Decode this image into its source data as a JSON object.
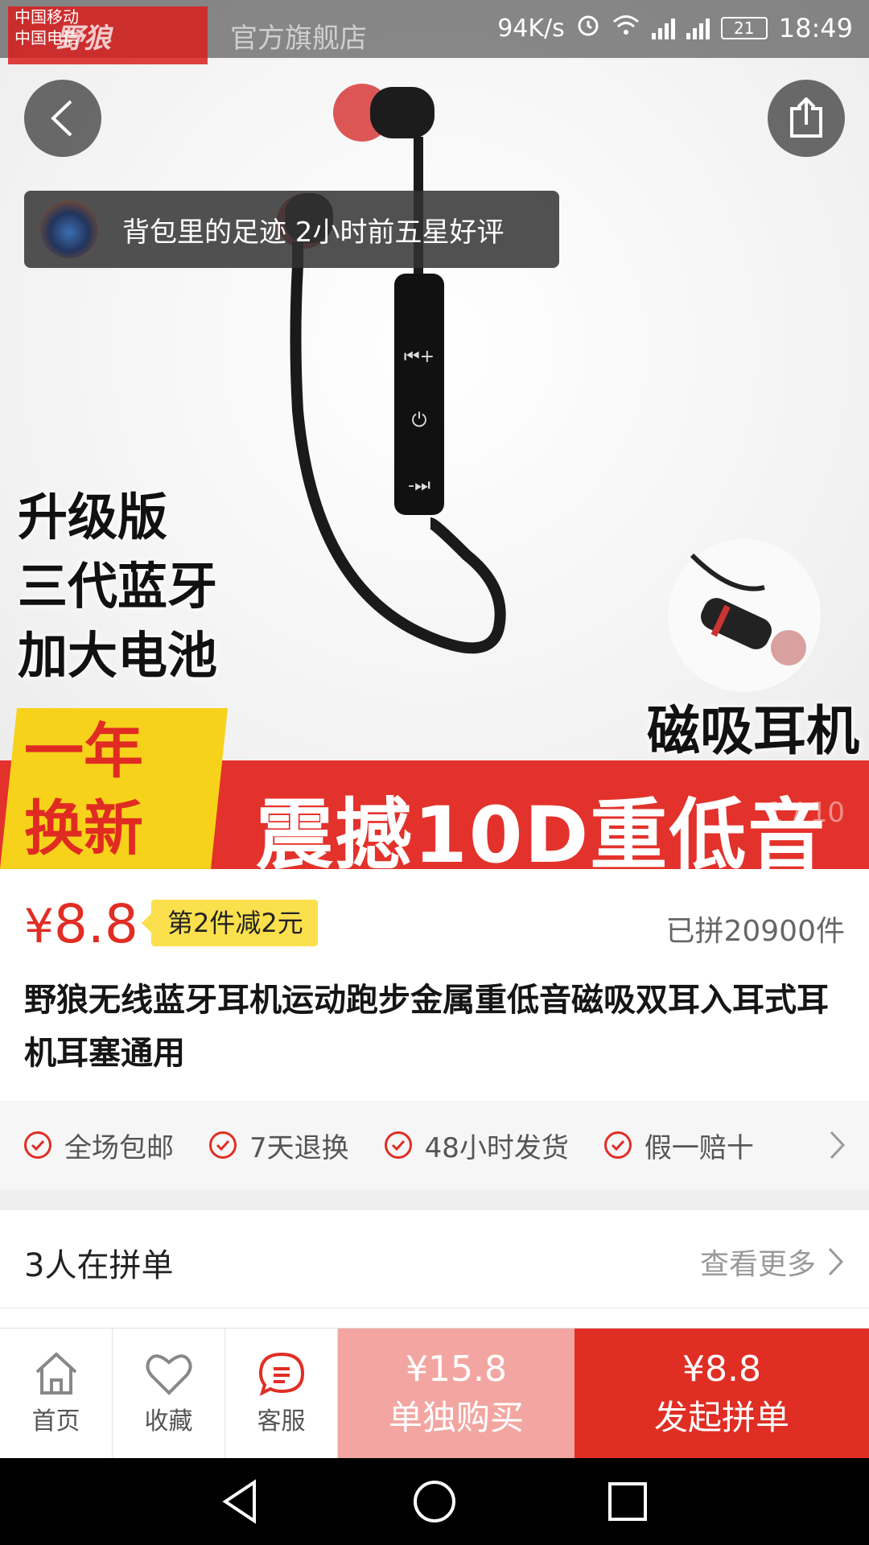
{
  "status_bar": {
    "carrier_1": "中国移动",
    "carrier_2": "中国电信",
    "store_name": "官方旗舰店",
    "brand_watermark": "野狼",
    "speed": "94K/s",
    "battery": "21",
    "time": "18:49",
    "network_1": "2G",
    "network_2": "4G 2G"
  },
  "hero": {
    "review_toast": "背包里的足迹  2小时前五星好评",
    "promo_lines": [
      "升级版",
      "三代蓝牙",
      "加大电池"
    ],
    "magnet_label": "磁吸耳机",
    "year_lines": [
      "一年",
      "换新"
    ],
    "band_text": "震撼10D重低音",
    "page_indicator": "1 / 10"
  },
  "product": {
    "price_symbol": "¥",
    "price": "8.8",
    "discount_tag": "第2件减2元",
    "sold": "已拼20900件",
    "title": "野狼无线蓝牙耳机运动跑步金属重低音磁吸双耳入耳式耳机耳塞通用"
  },
  "services": [
    "全场包邮",
    "7天退换",
    "48小时发货",
    "假一赔十"
  ],
  "group": {
    "title": "3人在拼单",
    "see_more": "查看更多"
  },
  "bottom_bar": {
    "home": "首页",
    "favorite": "收藏",
    "service": "客服",
    "buy_alone_price": "¥15.8",
    "buy_alone_label": "单独购买",
    "buy_group_price": "¥8.8",
    "buy_group_label": "发起拼单"
  },
  "colors": {
    "accent_red": "#e02e24",
    "light_red": "#f3a6a1",
    "tag_yellow": "#fbe04d"
  }
}
